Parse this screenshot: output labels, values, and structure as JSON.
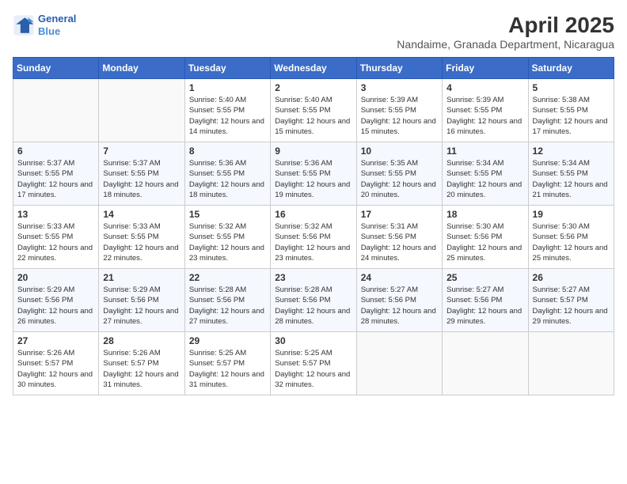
{
  "header": {
    "logo_line1": "General",
    "logo_line2": "Blue",
    "title": "April 2025",
    "subtitle": "Nandaime, Granada Department, Nicaragua"
  },
  "columns": [
    "Sunday",
    "Monday",
    "Tuesday",
    "Wednesday",
    "Thursday",
    "Friday",
    "Saturday"
  ],
  "weeks": [
    [
      {
        "day": "",
        "info": ""
      },
      {
        "day": "",
        "info": ""
      },
      {
        "day": "1",
        "info": "Sunrise: 5:40 AM\nSunset: 5:55 PM\nDaylight: 12 hours and 14 minutes."
      },
      {
        "day": "2",
        "info": "Sunrise: 5:40 AM\nSunset: 5:55 PM\nDaylight: 12 hours and 15 minutes."
      },
      {
        "day": "3",
        "info": "Sunrise: 5:39 AM\nSunset: 5:55 PM\nDaylight: 12 hours and 15 minutes."
      },
      {
        "day": "4",
        "info": "Sunrise: 5:39 AM\nSunset: 5:55 PM\nDaylight: 12 hours and 16 minutes."
      },
      {
        "day": "5",
        "info": "Sunrise: 5:38 AM\nSunset: 5:55 PM\nDaylight: 12 hours and 17 minutes."
      }
    ],
    [
      {
        "day": "6",
        "info": "Sunrise: 5:37 AM\nSunset: 5:55 PM\nDaylight: 12 hours and 17 minutes."
      },
      {
        "day": "7",
        "info": "Sunrise: 5:37 AM\nSunset: 5:55 PM\nDaylight: 12 hours and 18 minutes."
      },
      {
        "day": "8",
        "info": "Sunrise: 5:36 AM\nSunset: 5:55 PM\nDaylight: 12 hours and 18 minutes."
      },
      {
        "day": "9",
        "info": "Sunrise: 5:36 AM\nSunset: 5:55 PM\nDaylight: 12 hours and 19 minutes."
      },
      {
        "day": "10",
        "info": "Sunrise: 5:35 AM\nSunset: 5:55 PM\nDaylight: 12 hours and 20 minutes."
      },
      {
        "day": "11",
        "info": "Sunrise: 5:34 AM\nSunset: 5:55 PM\nDaylight: 12 hours and 20 minutes."
      },
      {
        "day": "12",
        "info": "Sunrise: 5:34 AM\nSunset: 5:55 PM\nDaylight: 12 hours and 21 minutes."
      }
    ],
    [
      {
        "day": "13",
        "info": "Sunrise: 5:33 AM\nSunset: 5:55 PM\nDaylight: 12 hours and 22 minutes."
      },
      {
        "day": "14",
        "info": "Sunrise: 5:33 AM\nSunset: 5:55 PM\nDaylight: 12 hours and 22 minutes."
      },
      {
        "day": "15",
        "info": "Sunrise: 5:32 AM\nSunset: 5:55 PM\nDaylight: 12 hours and 23 minutes."
      },
      {
        "day": "16",
        "info": "Sunrise: 5:32 AM\nSunset: 5:56 PM\nDaylight: 12 hours and 23 minutes."
      },
      {
        "day": "17",
        "info": "Sunrise: 5:31 AM\nSunset: 5:56 PM\nDaylight: 12 hours and 24 minutes."
      },
      {
        "day": "18",
        "info": "Sunrise: 5:30 AM\nSunset: 5:56 PM\nDaylight: 12 hours and 25 minutes."
      },
      {
        "day": "19",
        "info": "Sunrise: 5:30 AM\nSunset: 5:56 PM\nDaylight: 12 hours and 25 minutes."
      }
    ],
    [
      {
        "day": "20",
        "info": "Sunrise: 5:29 AM\nSunset: 5:56 PM\nDaylight: 12 hours and 26 minutes."
      },
      {
        "day": "21",
        "info": "Sunrise: 5:29 AM\nSunset: 5:56 PM\nDaylight: 12 hours and 27 minutes."
      },
      {
        "day": "22",
        "info": "Sunrise: 5:28 AM\nSunset: 5:56 PM\nDaylight: 12 hours and 27 minutes."
      },
      {
        "day": "23",
        "info": "Sunrise: 5:28 AM\nSunset: 5:56 PM\nDaylight: 12 hours and 28 minutes."
      },
      {
        "day": "24",
        "info": "Sunrise: 5:27 AM\nSunset: 5:56 PM\nDaylight: 12 hours and 28 minutes."
      },
      {
        "day": "25",
        "info": "Sunrise: 5:27 AM\nSunset: 5:56 PM\nDaylight: 12 hours and 29 minutes."
      },
      {
        "day": "26",
        "info": "Sunrise: 5:27 AM\nSunset: 5:57 PM\nDaylight: 12 hours and 29 minutes."
      }
    ],
    [
      {
        "day": "27",
        "info": "Sunrise: 5:26 AM\nSunset: 5:57 PM\nDaylight: 12 hours and 30 minutes."
      },
      {
        "day": "28",
        "info": "Sunrise: 5:26 AM\nSunset: 5:57 PM\nDaylight: 12 hours and 31 minutes."
      },
      {
        "day": "29",
        "info": "Sunrise: 5:25 AM\nSunset: 5:57 PM\nDaylight: 12 hours and 31 minutes."
      },
      {
        "day": "30",
        "info": "Sunrise: 5:25 AM\nSunset: 5:57 PM\nDaylight: 12 hours and 32 minutes."
      },
      {
        "day": "",
        "info": ""
      },
      {
        "day": "",
        "info": ""
      },
      {
        "day": "",
        "info": ""
      }
    ]
  ]
}
